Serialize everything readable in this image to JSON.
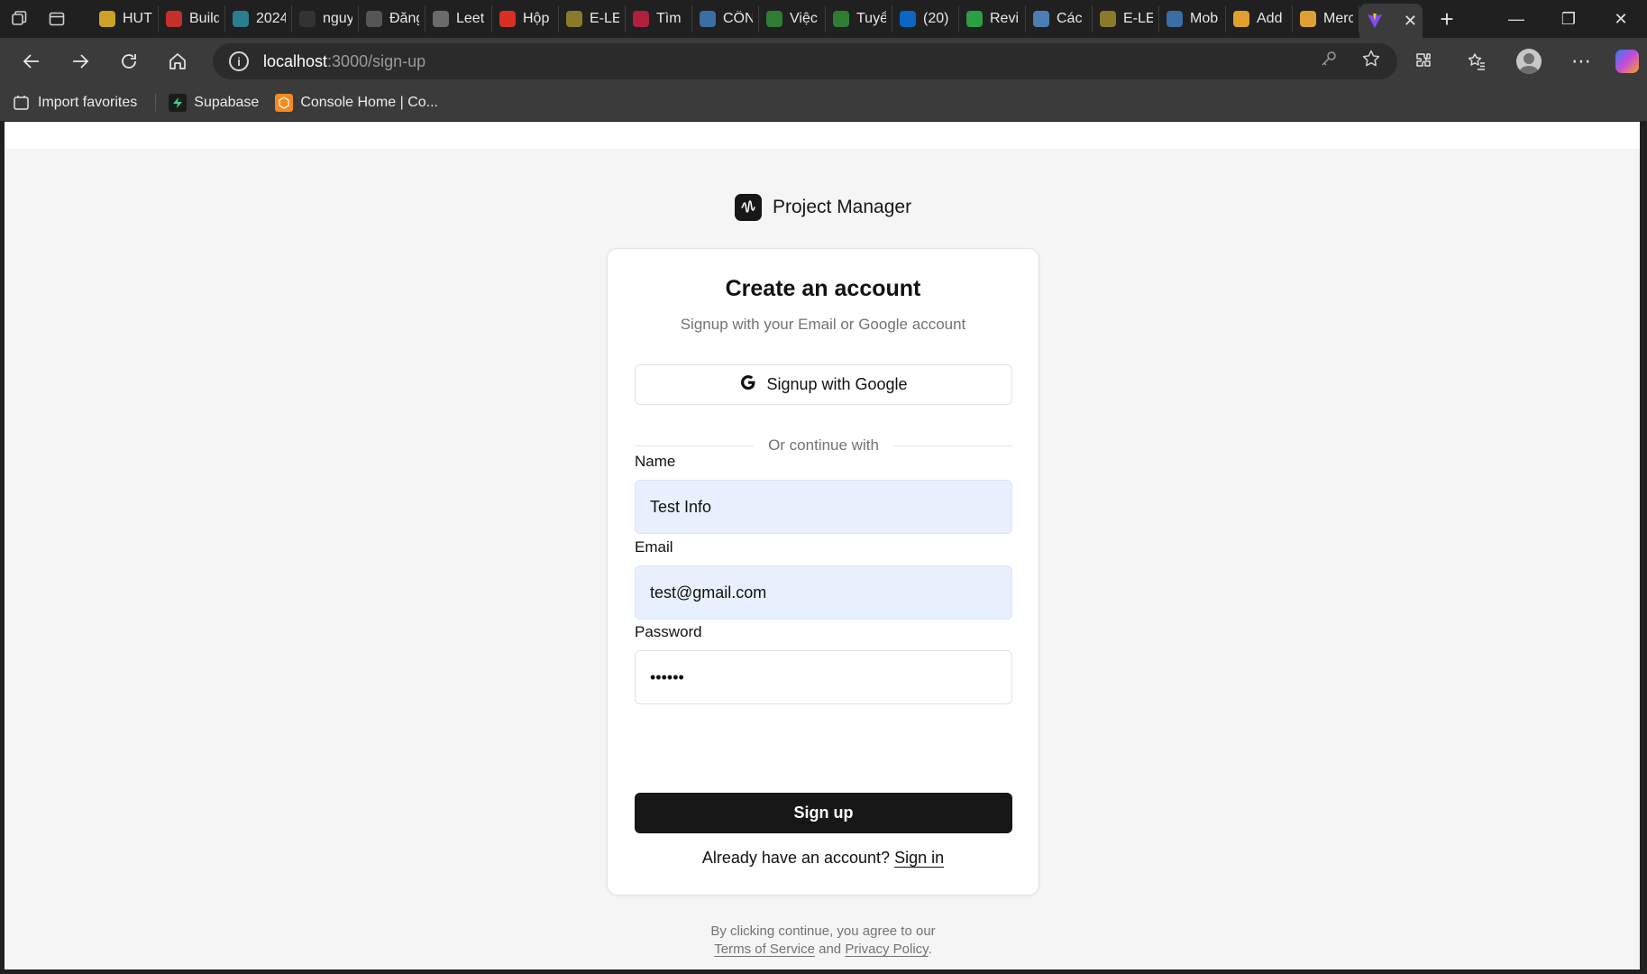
{
  "browser": {
    "tabs": [
      {
        "label": "HUT",
        "favicon_color": "#c9a227",
        "icon": "shield-icon"
      },
      {
        "label": "Build",
        "favicon_color": "#c4302b",
        "icon": "youtube-icon"
      },
      {
        "label": "2024",
        "favicon_color": "#2a7f8f",
        "icon": "classroom-icon"
      },
      {
        "label": "nguy",
        "favicon_color": "#333333",
        "icon": "github-icon"
      },
      {
        "label": "Đăng",
        "favicon_color": "#555555",
        "icon": "globe-icon"
      },
      {
        "label": "Leet",
        "favicon_color": "#6b6b6b",
        "icon": "openai-icon"
      },
      {
        "label": "Hộp",
        "favicon_color": "#d93025",
        "icon": "gmail-icon"
      },
      {
        "label": "E-LE",
        "favicon_color": "#8a7a2a",
        "icon": "elearning-icon"
      },
      {
        "label": "Tìm",
        "favicon_color": "#b0203a",
        "icon": "dot-icon"
      },
      {
        "label": "CÔN",
        "favicon_color": "#3a6ea5",
        "icon": "search-icon"
      },
      {
        "label": "Việc",
        "favicon_color": "#2e7d32",
        "icon": "topcv-icon"
      },
      {
        "label": "Tuyể",
        "favicon_color": "#2e7d32",
        "icon": "topcv-icon"
      },
      {
        "label": "(20)",
        "favicon_color": "#0a66c2",
        "icon": "linkedin-icon"
      },
      {
        "label": "Revi",
        "favicon_color": "#2e9e44",
        "icon": "heart-icon"
      },
      {
        "label": "Các",
        "favicon_color": "#4a7fb5",
        "icon": "bird-icon"
      },
      {
        "label": "E-LE",
        "favicon_color": "#8a7a2a",
        "icon": "elearning-icon"
      },
      {
        "label": "Mob",
        "favicon_color": "#3a6ea5",
        "icon": "search-icon"
      },
      {
        "label": "Add",
        "favicon_color": "#e0a030",
        "icon": "stack-icon"
      },
      {
        "label": "Merc",
        "favicon_color": "#e0a030",
        "icon": "stack-icon"
      }
    ],
    "active_tab": {
      "favicon_color": "#7c4dff",
      "icon": "vite-icon"
    },
    "url_host": "localhost",
    "url_path": ":3000/sign-up",
    "favorites": [
      {
        "label": "Import favorites",
        "icon": "import-icon"
      },
      {
        "label": "Supabase",
        "icon": "supabase-icon"
      },
      {
        "label": "Console Home | Co...",
        "icon": "aws-icon"
      }
    ]
  },
  "page": {
    "brand_name": "Project Manager",
    "title": "Create an account",
    "subtitle": "Signup with your Email or Google account",
    "google_button": "Signup with Google",
    "divider_text": "Or continue with",
    "fields": {
      "name": {
        "label": "Name",
        "value": "Test Info"
      },
      "email": {
        "label": "Email",
        "value": "test@gmail.com"
      },
      "password": {
        "label": "Password",
        "value": "••••••"
      }
    },
    "submit": "Sign up",
    "switch_prompt": "Already have an account?",
    "switch_link": "Sign in",
    "legal_prefix": "By clicking continue, you agree to our",
    "terms_link": "Terms of Service",
    "legal_and": "and",
    "privacy_link": "Privacy Policy",
    "legal_suffix": "."
  },
  "colors": {
    "accent_dark": "#171717",
    "autofill_bg": "#e8f0fe",
    "muted_text": "#737373",
    "page_bg": "#f5f5f5"
  }
}
